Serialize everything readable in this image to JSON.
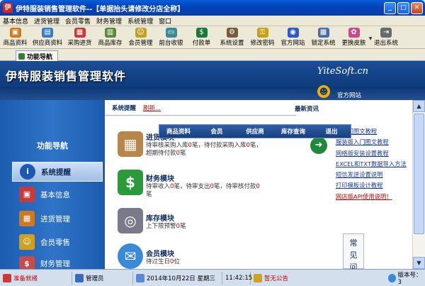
{
  "window": {
    "title": "伊特服装销售管理软件--【单据抬头请修改分店全称】",
    "icon": "app-icon"
  },
  "menu": [
    "基本信息",
    "进货管理",
    "会员零售",
    "财务管理",
    "系统管理",
    "窗口"
  ],
  "toolbar": [
    {
      "label": "商品资料",
      "icon": "product-icon",
      "color": "#d07a20"
    },
    {
      "label": "供应商资料",
      "icon": "supplier-icon",
      "color": "#3a7ac8"
    },
    {
      "label": "采购进货",
      "icon": "purchase-icon",
      "color": "#c83a3a"
    },
    {
      "label": "商品库存",
      "icon": "inventory-icon",
      "color": "#5a8a3a"
    },
    {
      "label": "会员管理",
      "icon": "member-icon",
      "color": "#c8a020"
    },
    {
      "label": "前台收银",
      "icon": "cashier-icon",
      "color": "#3a8a9a"
    },
    {
      "label": "付款单",
      "icon": "payment-icon",
      "color": "#1a7a3a"
    },
    {
      "label": "系统设置",
      "icon": "settings-icon",
      "color": "#7a5a3a"
    },
    {
      "label": "修改密码",
      "icon": "password-icon",
      "color": "#c8a020"
    },
    {
      "label": "官方网站",
      "icon": "website-icon",
      "color": "#2a5ac8"
    },
    {
      "label": "锁定系统",
      "icon": "lock-icon",
      "color": "#4a6aa8"
    },
    {
      "label": "更换皮肤",
      "icon": "skin-icon",
      "color": "#c84a8a"
    },
    {
      "label": "退出系统",
      "icon": "exit-icon",
      "color": "#6a6a6a"
    }
  ],
  "tab": {
    "label": "功能导航"
  },
  "banner": {
    "logo": "伊特服装销售管理软件",
    "brand": "YiteSoft.cn",
    "site": "官方网站"
  },
  "sidebar": {
    "header": "功能导航",
    "items": [
      {
        "label": "系统提醒",
        "icon": "info-icon",
        "color": "#1a5ab0"
      },
      {
        "label": "基本信息",
        "icon": "cubes-icon",
        "color": "#c83a3a"
      },
      {
        "label": "进货管理",
        "icon": "box-icon",
        "color": "#d07a20"
      },
      {
        "label": "会员零售",
        "icon": "member-icon",
        "color": "#d0a020"
      },
      {
        "label": "财务管理",
        "icon": "finance-icon",
        "color": "#c84a4a"
      }
    ]
  },
  "content": {
    "reminder_title": "系统提醒",
    "refresh": "刷新...",
    "news_title": "最新资讯",
    "float_menu": [
      "商品资料",
      "会员",
      "供应商",
      "库存查询",
      "退出"
    ],
    "modules": [
      {
        "title": "进货模块",
        "lines": [
          [
            "待审核采购入库",
            "0",
            "笔，待付款采购入库",
            "0",
            "笔，"
          ],
          [
            "超期待付款",
            "0",
            "笔",
            "",
            " "
          ]
        ],
        "icon": "box-icon",
        "color": "#b8864a"
      },
      {
        "title": "财务模块",
        "lines": [
          [
            "待审收入",
            "0",
            "笔，待审支出",
            "0",
            "笔，待审核付款",
            "0",
            "笔"
          ]
        ],
        "extra": "笔",
        "icon": "money-icon",
        "color": "#2a9a3a"
      },
      {
        "title": "库存模块",
        "lines": [
          [
            "上下限预警",
            "0",
            "笔",
            "",
            ""
          ]
        ],
        "icon": "database-icon",
        "color": "#7a7a8a"
      },
      {
        "title": "会员模块",
        "lines": [
          [
            "待过生日",
            "0",
            "位",
            "",
            ""
          ]
        ],
        "icon": "chat-icon",
        "color": "#3a8ad8"
      }
    ],
    "news": [
      {
        "text": "速入门图文教程",
        "red": false
      },
      {
        "text": "服装版入门图文教程",
        "red": false
      },
      {
        "text": "网络版安装设置教程",
        "red": false
      },
      {
        "text": "EXCEL和TXT数据导入方法",
        "red": false
      },
      {
        "text": "短信发送设置说明",
        "red": false
      },
      {
        "text": "打印模板设计教程",
        "red": false
      },
      {
        "text": "网店版API使用说明！",
        "red": true
      }
    ],
    "faq": "常见问"
  },
  "status": {
    "ready": "准备就绪",
    "user": "管理员",
    "datetime": "2014年10月22日 星期三",
    "time": "11:42:15",
    "notice": "暂无公告",
    "version": "版本号：3"
  }
}
